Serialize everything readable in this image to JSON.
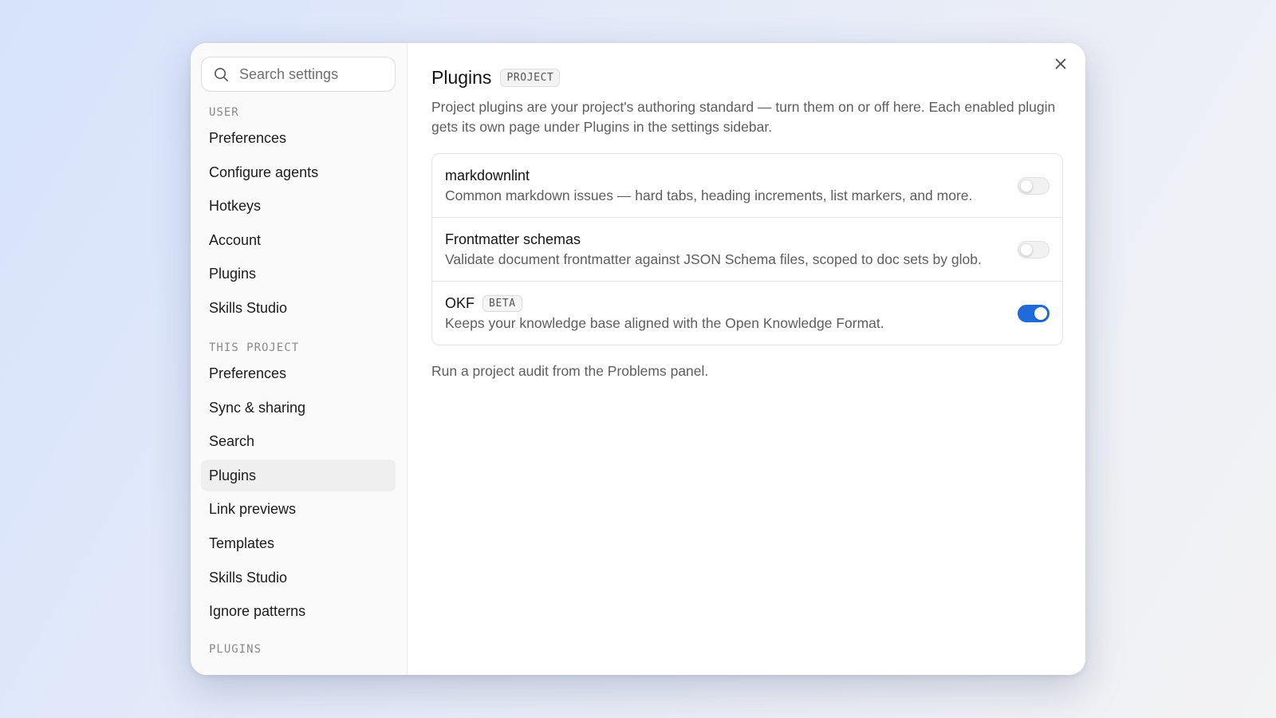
{
  "search": {
    "placeholder": "Search settings",
    "icon": "search-icon"
  },
  "sidebar": {
    "user_label": "USER",
    "user_items": [
      {
        "label": "Preferences"
      },
      {
        "label": "Configure agents"
      },
      {
        "label": "Hotkeys"
      },
      {
        "label": "Account"
      },
      {
        "label": "Plugins"
      },
      {
        "label": "Skills Studio"
      }
    ],
    "project_label": "THIS PROJECT",
    "project_items": [
      {
        "label": "Preferences"
      },
      {
        "label": "Sync & sharing"
      },
      {
        "label": "Search"
      },
      {
        "label": "Plugins",
        "active": true
      },
      {
        "label": "Link previews"
      },
      {
        "label": "Templates"
      },
      {
        "label": "Skills Studio"
      },
      {
        "label": "Ignore patterns"
      }
    ],
    "plugins_label": "PLUGINS"
  },
  "main": {
    "title": "Plugins",
    "scope_badge": "PROJECT",
    "description": "Project plugins are your project's authoring standard — turn them on or off here. Each enabled plugin gets its own page under Plugins in the settings sidebar.",
    "plugins": [
      {
        "name": "markdownlint",
        "description": "Common markdown issues — hard tabs, heading increments, list markers, and more.",
        "enabled": false
      },
      {
        "name": "Frontmatter schemas",
        "description": "Validate document frontmatter against JSON Schema files, scoped to doc sets by glob.",
        "enabled": false
      },
      {
        "name": "OKF",
        "badge": "BETA",
        "description": "Keeps your knowledge base aligned with the Open Knowledge Format.",
        "enabled": true
      }
    ],
    "footer_note": "Run a project audit from the Problems panel."
  },
  "colors": {
    "accent": "#1f6bd9",
    "active_nav_bg": "#efefef"
  },
  "close_icon": "close-icon"
}
